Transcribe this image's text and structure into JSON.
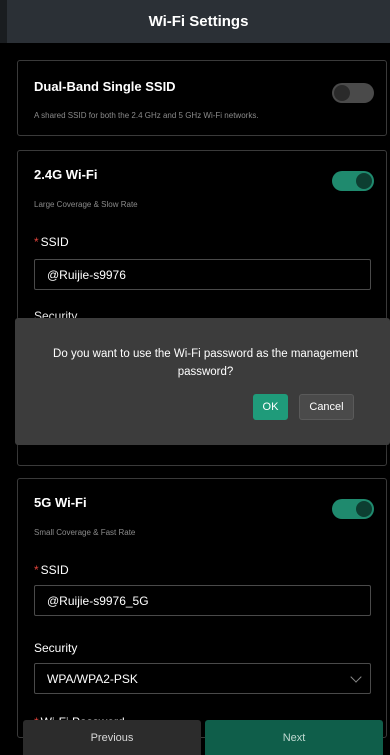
{
  "header": {
    "title": "Wi-Fi Settings"
  },
  "dual_band": {
    "title": "Dual-Band Single SSID",
    "description": "A shared SSID for both the 2.4 GHz and 5 GHz Wi-Fi networks.",
    "enabled": false
  },
  "wifi24": {
    "title": "2.4G Wi-Fi",
    "description": "Large Coverage & Slow Rate",
    "enabled": true,
    "ssid_label": "SSID",
    "ssid_value": "@Ruijie-s9976",
    "security_label": "Security"
  },
  "wifi5": {
    "title": "5G Wi-Fi",
    "description": "Small Coverage & Fast Rate",
    "enabled": true,
    "ssid_label": "SSID",
    "ssid_value": "@Ruijie-s9976_5G",
    "security_label": "Security",
    "security_value": "WPA/WPA2-PSK",
    "password_label": "Wi-Fi Password"
  },
  "dialog": {
    "message": "Do you want to use the Wi-Fi password as the management password?",
    "ok_label": "OK",
    "cancel_label": "Cancel"
  },
  "footer": {
    "previous_label": "Previous",
    "next_label": "Next"
  },
  "colors": {
    "accent": "#1f9b7a",
    "toggle_on": "#1f8a6e",
    "required": "#e0443c"
  }
}
